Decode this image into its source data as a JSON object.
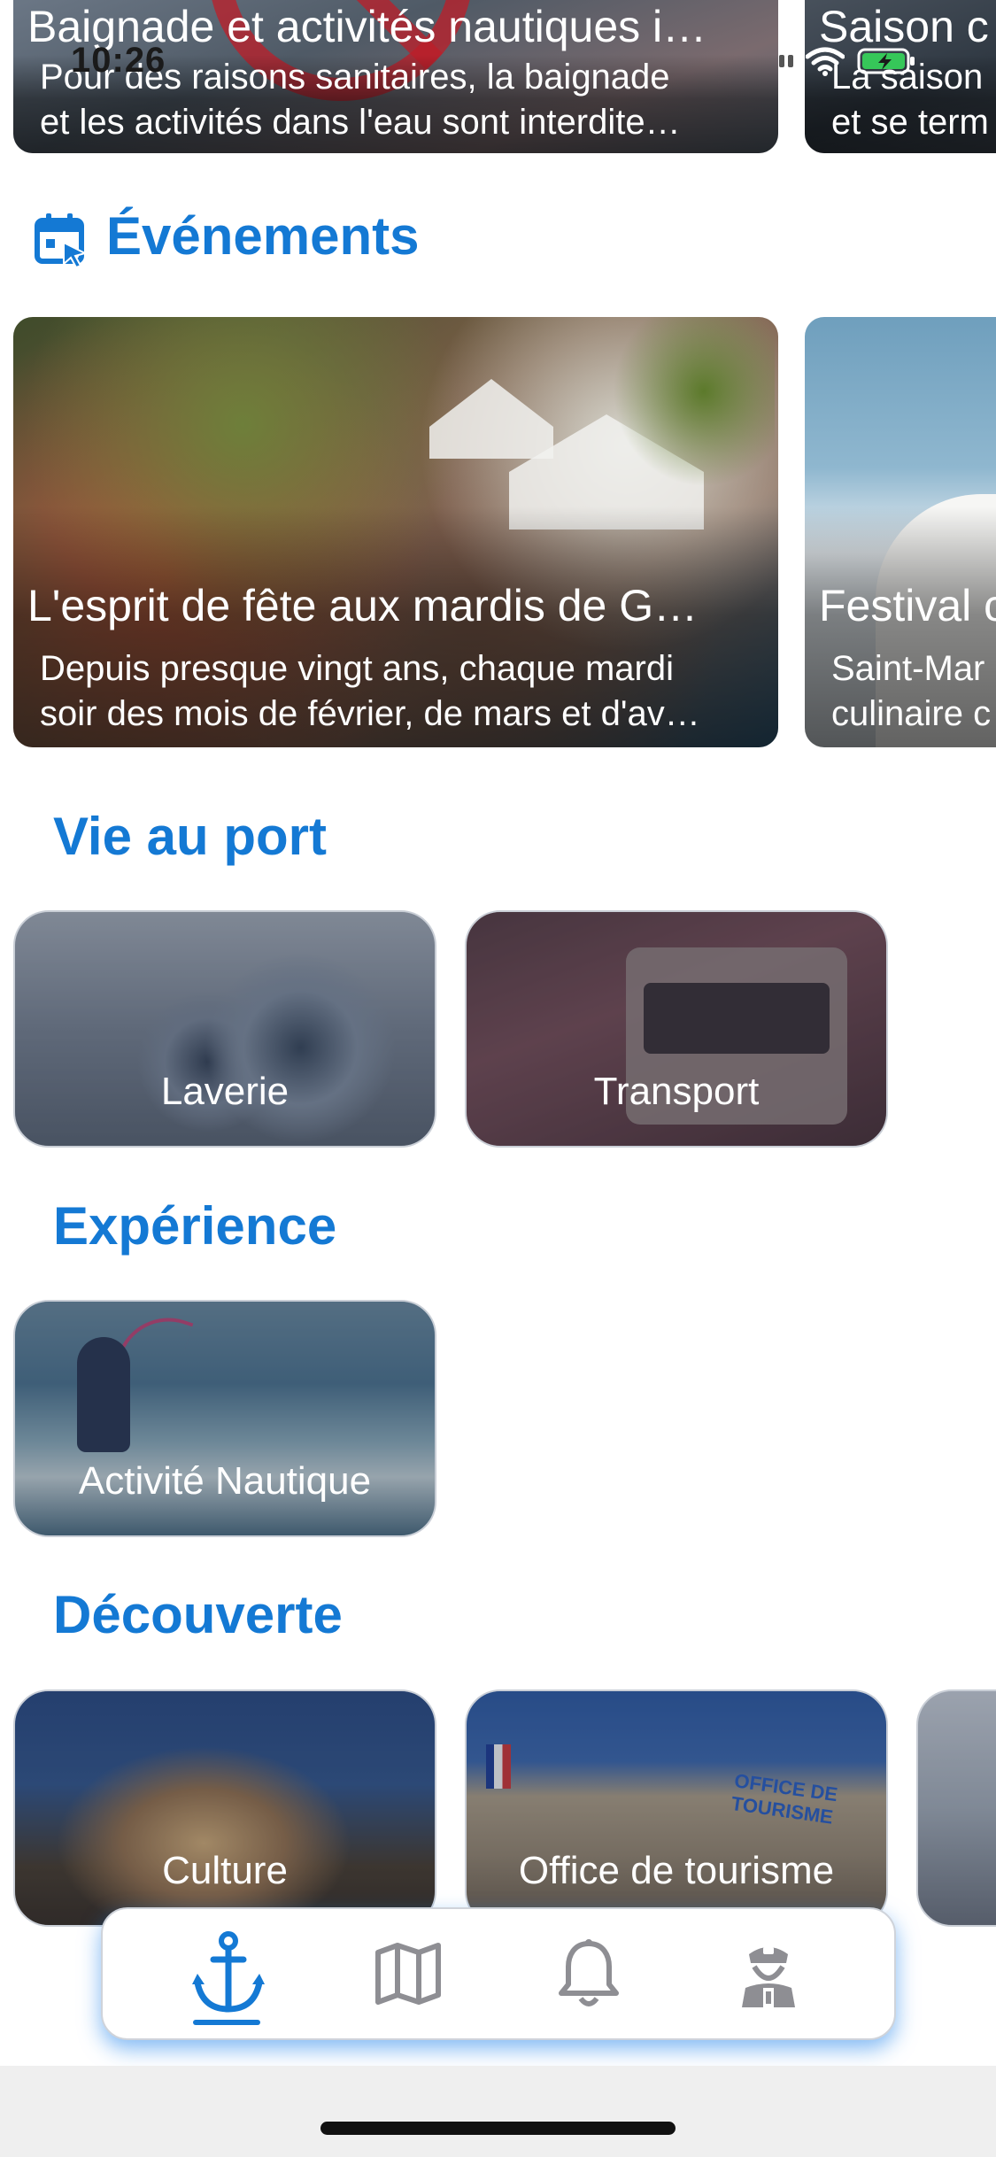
{
  "status_bar": {
    "time": "10:26"
  },
  "news": [
    {
      "title": "Baignade et activités nautiques i…",
      "desc_lines": [
        "Pour des raisons sanitaires, la baignade",
        "et les activités dans l'eau sont interdite…"
      ]
    },
    {
      "title": "Saison c",
      "desc_lines": [
        "La saison",
        "et se term"
      ]
    }
  ],
  "events_section": {
    "title": "Événements",
    "icon": "calendar-icon"
  },
  "events": [
    {
      "title": "L'esprit de fête aux mardis de G…",
      "desc_lines": [
        "Depuis presque vingt ans, chaque mardi",
        "soir des mois de février, de mars et d'av…"
      ]
    },
    {
      "title": "Festival c",
      "desc_lines": [
        "Saint-Mar",
        "culinaire c"
      ]
    }
  ],
  "sections": {
    "vie_au_port": {
      "title": "Vie au port",
      "tiles": [
        "Laverie",
        "Transport"
      ]
    },
    "experience": {
      "title": "Expérience",
      "tiles": [
        "Activité Nautique"
      ]
    },
    "decouverte": {
      "title": "Découverte",
      "tiles": [
        "Culture",
        "Office de tourisme",
        ""
      ]
    }
  },
  "office_sign": "OFFICE DE TOURISME",
  "tabbar": {
    "tabs": [
      {
        "icon": "anchor-icon",
        "active": true
      },
      {
        "icon": "map-icon",
        "active": false
      },
      {
        "icon": "bell-icon",
        "active": false
      },
      {
        "icon": "captain-icon",
        "active": false
      }
    ]
  },
  "colors": {
    "accent": "#1479d4",
    "inactive_icon": "#8e8e93"
  }
}
